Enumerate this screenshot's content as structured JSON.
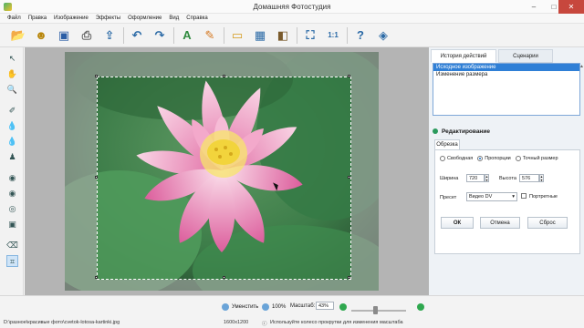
{
  "window": {
    "title": "Домашняя Фотостудия",
    "controls": {
      "minimize": "–",
      "maximize": "□",
      "close": "✕"
    }
  },
  "menu": [
    "Файл",
    "Правка",
    "Изображение",
    "Эффекты",
    "Оформление",
    "Вид",
    "Справка"
  ],
  "toolbar": {
    "groups": [
      [
        "open-folder-icon",
        "gallery-icon",
        "save-icon",
        "print-icon",
        "export-icon"
      ],
      [
        "undo-icon",
        "redo-icon"
      ],
      [
        "text-tool-icon",
        "palette-icon"
      ],
      [
        "frame-icon",
        "calendar-icon",
        "collage-icon"
      ],
      [
        "fit-screen-icon",
        "actual-size-icon"
      ],
      [
        "help-icon",
        "cube-icon"
      ]
    ],
    "glyphs": {
      "open-folder-icon": "📂",
      "gallery-icon": "☻",
      "save-icon": "▣",
      "print-icon": "⎙",
      "export-icon": "⇪",
      "undo-icon": "↶",
      "redo-icon": "↷",
      "text-tool-icon": "A",
      "palette-icon": "✎",
      "frame-icon": "▭",
      "calendar-icon": "▦",
      "collage-icon": "◧",
      "fit-screen-icon": "⛶",
      "actual-size-icon": "1:1",
      "help-icon": "?",
      "cube-icon": "◈"
    }
  },
  "left_tools": [
    "pointer-icon",
    "hand-icon",
    "zoom-icon",
    "brush-icon",
    "drop-icon",
    "blur-icon",
    "stamp-icon",
    "eye-icon",
    "redeye-icon",
    "lens-icon",
    "color-icon",
    "eraser-icon",
    "crop-icon"
  ],
  "left_tool_glyphs": {
    "pointer-icon": "↖",
    "hand-icon": "✋",
    "zoom-icon": "🔍",
    "brush-icon": "✐",
    "drop-icon": "💧",
    "blur-icon": "💧",
    "stamp-icon": "♟",
    "eye-icon": "◉",
    "redeye-icon": "◉",
    "lens-icon": "◎",
    "color-icon": "▣",
    "eraser-icon": "⌫",
    "crop-icon": "⌗"
  },
  "right_panel": {
    "tabs": [
      "История действий",
      "Сценарии"
    ],
    "history": [
      "Исходное изображение",
      "Изменение размера"
    ],
    "edit_title": "Редактирование",
    "sub_tab": "Обрезка",
    "modes": [
      "Свободная",
      "Пропорции",
      "Точный размер"
    ],
    "selected_mode": "Пропорции",
    "width_label": "Ширина",
    "width_value": "720",
    "height_label": "Высота",
    "height_value": "576",
    "preset_label": "Пресет",
    "preset_value": "Видео DV",
    "portrait_label": "Портретные",
    "portrait_checked": false,
    "ok": "ОК",
    "cancel": "Отмена",
    "reset": "Сброс"
  },
  "status": {
    "shrink_label": "Уменстить",
    "zoom_100_label": "100%",
    "scale_label": "Масштаб:",
    "scale_value": "43%",
    "scale_fraction": 0.43,
    "file_path": "D:\\разное\\красивые фото\\cvetok-lotosa-kartinki.jpg",
    "dimensions": "1600x1200",
    "hint": "Используйте колесо прокрутки для изменения масштаба"
  },
  "colors": {
    "accent": "#2f7fd6",
    "petal_light": "#f6c8dc",
    "petal_dark": "#e06fa5",
    "center": "#f2d43c",
    "leaf": "#3c8b4d",
    "zoom_green": "#2fa84f"
  }
}
